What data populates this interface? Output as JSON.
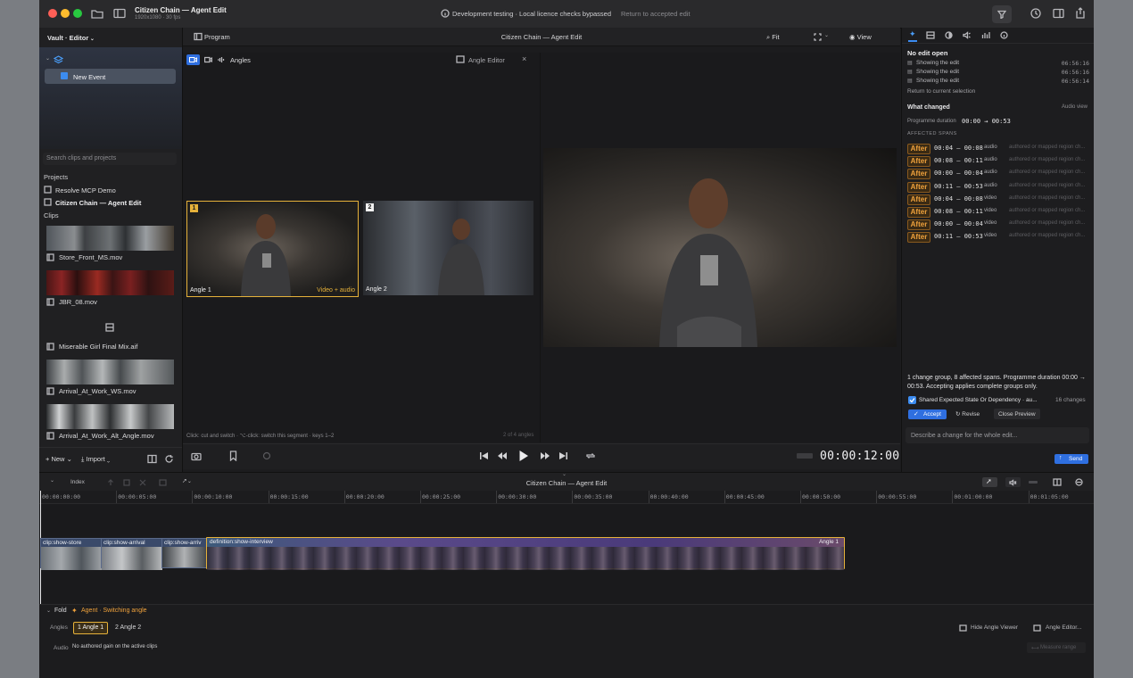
{
  "window": {
    "title": "Citizen Chain — Agent Edit",
    "subtitle": "1920x1080 · 30 fps",
    "notice": "Development testing · Local licence checks bypassed",
    "notice_link": "Return to accepted edit"
  },
  "sidebar": {
    "library_menu": "Vault · Editor",
    "event_label": "New Event",
    "search_placeholder": "Search clips and projects",
    "projects_header": "Projects",
    "projects": [
      "Resolve MCP Demo",
      "Citizen Chain — Agent Edit"
    ],
    "clips_header": "Clips",
    "clips": [
      "Store_Front_MS.mov",
      "JBR_08.mov",
      "Miserable Girl Final Mix.aif",
      "Arrival_At_Work_WS.mov",
      "Arrival_At_Work_Alt_Angle.mov"
    ],
    "new_label": "New",
    "import_label": "Import"
  },
  "viewer": {
    "program_tab": "Program",
    "title": "Citizen Chain — Agent Edit",
    "fit_label": "Fit",
    "view_label": "View",
    "angles_label": "Angles",
    "angle_editor_label": "Angle Editor",
    "angle1_label": "Angle 1",
    "angle1_badge": "1",
    "angle1_tag": "Video + audio",
    "angle2_label": "Angle 2",
    "angle2_badge": "2",
    "hint": "Click: cut and switch · ⌥-click: switch this segment · keys 1–2",
    "count": "2 of 4 angles",
    "timecode": "00:00:12:00"
  },
  "inspector": {
    "no_edit": "No edit open",
    "history": [
      {
        "label": "Showing the edit",
        "time": "06:56:16"
      },
      {
        "label": "Showing the edit",
        "time": "06:56:16"
      },
      {
        "label": "Showing the edit",
        "time": "06:56:14"
      }
    ],
    "return_label": "Return to current selection",
    "what_changed": "What changed",
    "audio_view": "Audio view",
    "prog_duration_label": "Programme duration",
    "prog_duration_value": "00:00 → 00:53",
    "affected_header": "AFFECTED SPANS",
    "spans": [
      {
        "tag": "After",
        "range": "00:04 – 00:08",
        "kind": "audio",
        "desc": "authored or mapped region ch..."
      },
      {
        "tag": "After",
        "range": "00:08 – 00:11",
        "kind": "audio",
        "desc": "authored or mapped region ch..."
      },
      {
        "tag": "After",
        "range": "00:00 – 00:04",
        "kind": "audio",
        "desc": "authored or mapped region ch..."
      },
      {
        "tag": "After",
        "range": "00:11 – 00:53",
        "kind": "audio",
        "desc": "authored or mapped region ch..."
      },
      {
        "tag": "After",
        "range": "00:04 – 00:08",
        "kind": "video",
        "desc": "authored or mapped region ch..."
      },
      {
        "tag": "After",
        "range": "00:08 – 00:11",
        "kind": "video",
        "desc": "authored or mapped region ch..."
      },
      {
        "tag": "After",
        "range": "00:00 – 00:04",
        "kind": "video",
        "desc": "authored or mapped region ch..."
      },
      {
        "tag": "After",
        "range": "00:11 – 00:53",
        "kind": "video",
        "desc": "authored or mapped region ch..."
      }
    ],
    "summary": "1 change group, 8 affected spans. Programme duration 00:00 → 00:53. Accepting applies complete groups only.",
    "group_label": "Shared Expected State Or Dependency · au...",
    "group_count": "16 changes",
    "accept_label": "Accept",
    "revise_label": "Revise",
    "close_preview_label": "Close Preview",
    "describe_placeholder": "Describe a change for the whole edit...",
    "send_label": "Send"
  },
  "timeline": {
    "index_tab": "Index",
    "title": "Citizen Chain — Agent Edit",
    "ruler": [
      "00:00:00:00",
      "00:00:05:00",
      "00:00:10:00",
      "00:00:15:00",
      "00:00:20:00",
      "00:00:25:00",
      "00:00:30:00",
      "00:00:35:00",
      "00:00:40:00",
      "00:00:45:00",
      "00:00:50:00",
      "00:00:55:00",
      "00:01:00:00",
      "00:01:05:00"
    ],
    "clips": [
      "clip:show-store",
      "clip:show-arrival",
      "clip:show-arriv",
      "definition:show-interview"
    ],
    "angle_tag": "Angle 1",
    "fold_label": "Fold",
    "agent_status": "Agent · Switching angle",
    "angles_label": "Angles",
    "angle_buttons": [
      "1 Angle 1",
      "2 Angle 2"
    ],
    "audio_label": "Audio",
    "audio_note": "No authored gain on the active clips",
    "hide_angle_viewer": "Hide Angle Viewer",
    "angle_editor": "Angle Editor...",
    "measure": "Measure range"
  },
  "colors": {
    "accent_blue": "#2f7df6",
    "angle_gold": "#e6b23a",
    "after_orange": "#f0a23c"
  }
}
